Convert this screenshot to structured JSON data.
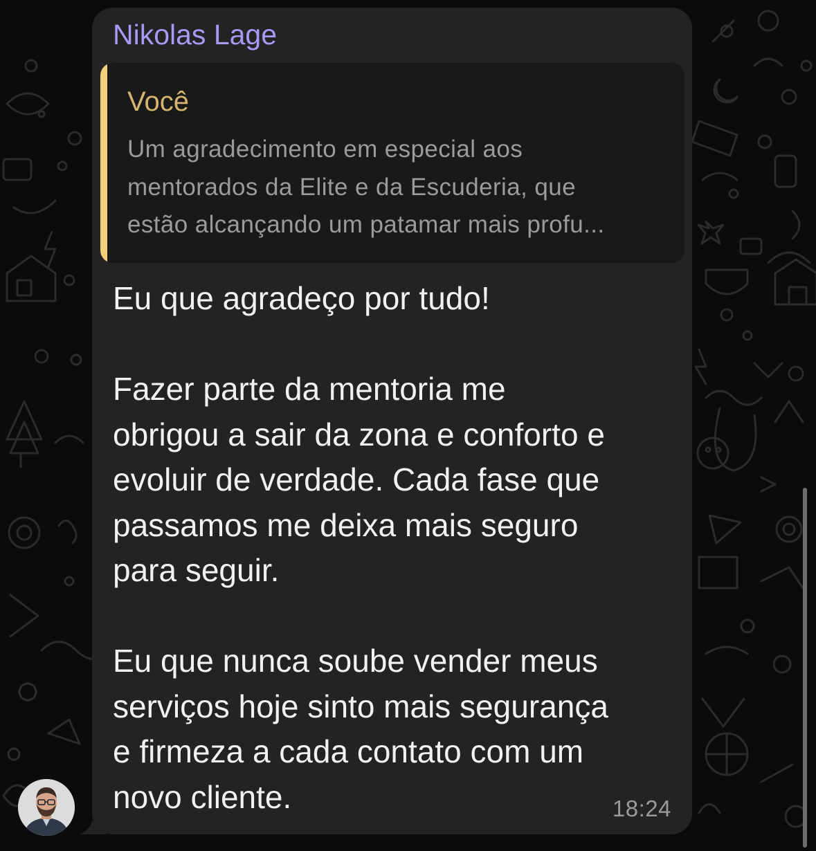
{
  "chat": {
    "sender_name": "Nikolas Lage",
    "quoted": {
      "author": "Você",
      "lines": [
        "Um agradecimento em especial aos",
        "mentorados da Elite e da Escuderia, que",
        "estão alcançando um patamar mais profu..."
      ]
    },
    "message_lines": [
      "Eu que agradeço por tudo!",
      "",
      "Fazer parte da mentoria me",
      "obrigou a sair da zona e conforto e",
      "evoluir de verdade. Cada fase que",
      "passamos me deixa mais seguro",
      "para seguir.",
      "",
      "Eu que nunca soube vender meus",
      "serviços hoje sinto mais segurança",
      "e firmeza a cada contato com um",
      "novo cliente."
    ],
    "timestamp": "18:24"
  },
  "colors": {
    "background": "#0b0b0b",
    "bubble": "#232323",
    "sender": "#a79af4",
    "quote_bar": "#f2ce7a",
    "quote_author": "#d6b46f"
  },
  "icons": {
    "wallpaper": "doodle-pattern",
    "avatar": "user-avatar"
  }
}
